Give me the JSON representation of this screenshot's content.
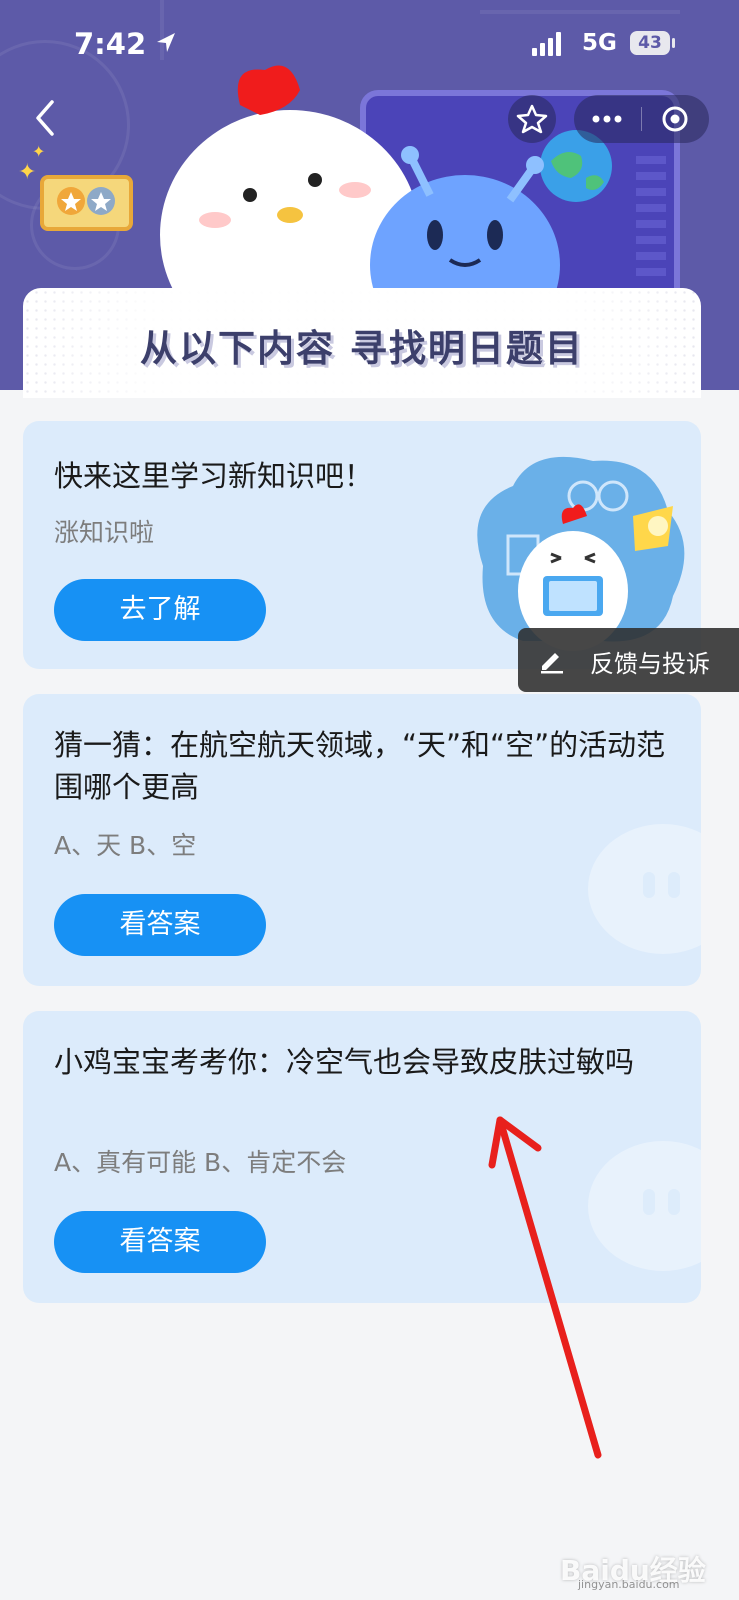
{
  "status_bar": {
    "time": "7:42",
    "network": "5G",
    "battery": "43"
  },
  "header": {
    "banner_title": "从以下内容  寻找明日题目"
  },
  "cards": [
    {
      "title": "快来这里学习新知识吧！",
      "subtitle": "涨知识啦",
      "button": "去了解"
    },
    {
      "title": "猜一猜：在航空航天领域，“天”和“空”的活动范围哪个更高",
      "options": "A、天    B、空",
      "button": "看答案"
    },
    {
      "title": "小鸡宝宝考考你：冷空气也会导致皮肤过敏吗",
      "options": "A、真有可能    B、肯定不会",
      "button": "看答案"
    }
  ],
  "feedback": {
    "label": "反馈与投诉"
  },
  "watermark": {
    "text": "Baidu经验",
    "url": "jingyan.baidu.com"
  },
  "colors": {
    "header_bg": "#5d5aa8",
    "card_bg": "#dcebfb",
    "button_blue": "#1791f4",
    "arrow_red": "#e8201c"
  },
  "icons": [
    "location-arrow-icon",
    "signal-icon",
    "back-icon",
    "star-icon",
    "more-icon",
    "target-icon",
    "edit-icon",
    "medal-icon"
  ]
}
